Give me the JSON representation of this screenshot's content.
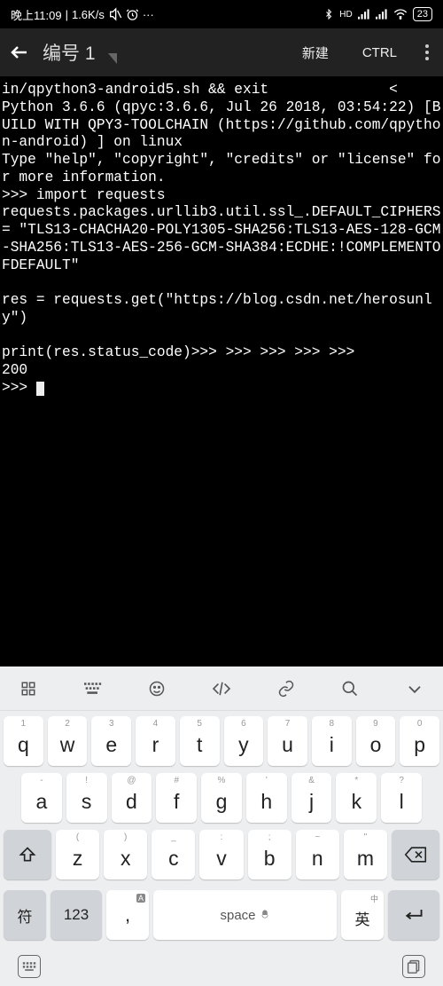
{
  "status": {
    "time": "晚上11:09",
    "speed": "1.6K/s",
    "battery": "23"
  },
  "header": {
    "title": "编号 1",
    "new_btn": "新建",
    "ctrl_btn": "CTRL"
  },
  "terminal": {
    "output": "in/qpython3-android5.sh && exit              <\nPython 3.6.6 (qpyc:3.6.6, Jul 26 2018, 03:54:22) [BUILD WITH QPY3-TOOLCHAIN (https://github.com/qpython-android) ] on linux\nType \"help\", \"copyright\", \"credits\" or \"license\" for more information.\n>>> import requests\nrequests.packages.urllib3.util.ssl_.DEFAULT_CIPHERS = \"TLS13-CHACHA20-POLY1305-SHA256:TLS13-AES-128-GCM-SHA256:TLS13-AES-256-GCM-SHA384:ECDHE:!COMPLEMENTOFDEFAULT\"\n\nres = requests.get(\"https://blog.csdn.net/herosunly\")\n\nprint(res.status_code)>>> >>> >>> >>> >>>\n200\n>>> "
  },
  "keyboard": {
    "row1": [
      {
        "sup": "1",
        "main": "q"
      },
      {
        "sup": "2",
        "main": "w"
      },
      {
        "sup": "3",
        "main": "e"
      },
      {
        "sup": "4",
        "main": "r"
      },
      {
        "sup": "5",
        "main": "t"
      },
      {
        "sup": "6",
        "main": "y"
      },
      {
        "sup": "7",
        "main": "u"
      },
      {
        "sup": "8",
        "main": "i"
      },
      {
        "sup": "9",
        "main": "o"
      },
      {
        "sup": "0",
        "main": "p"
      }
    ],
    "row2": [
      {
        "sup": "-",
        "main": "a"
      },
      {
        "sup": "!",
        "main": "s"
      },
      {
        "sup": "@",
        "main": "d"
      },
      {
        "sup": "#",
        "main": "f"
      },
      {
        "sup": "%",
        "main": "g"
      },
      {
        "sup": "'",
        "main": "h"
      },
      {
        "sup": "&",
        "main": "j"
      },
      {
        "sup": "*",
        "main": "k"
      },
      {
        "sup": "?",
        "main": "l"
      }
    ],
    "row3": [
      {
        "sup": "(",
        "main": "z"
      },
      {
        "sup": ")",
        "main": "x"
      },
      {
        "sup": "_",
        "main": "c"
      },
      {
        "sup": ":",
        "main": "v"
      },
      {
        "sup": ";",
        "main": "b"
      },
      {
        "sup": "~",
        "main": "n"
      },
      {
        "sup": "\"",
        "main": "m"
      }
    ],
    "bottom": {
      "sym": "符",
      "num": "123",
      "comma": ",",
      "comma_sup": "A",
      "space": "space",
      "lang": "英",
      "lang_sup": "中"
    }
  }
}
